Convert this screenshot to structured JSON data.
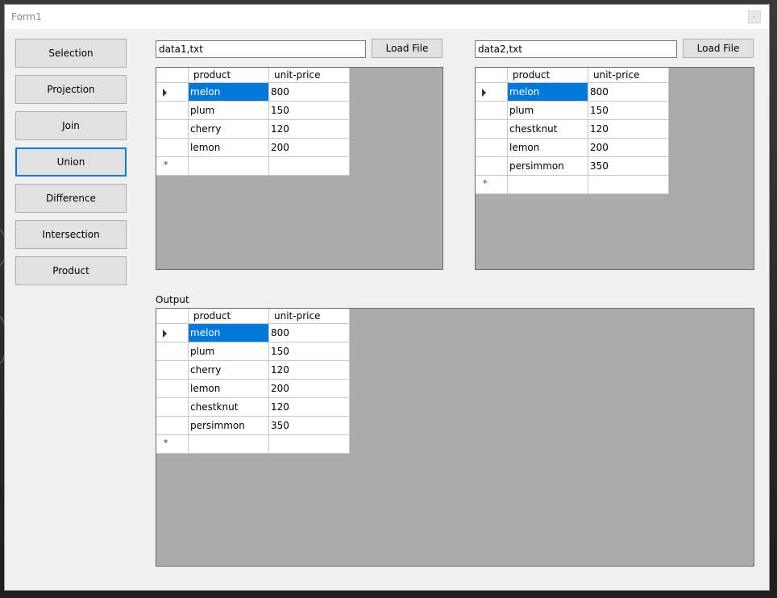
{
  "window": {
    "title": "Form1",
    "minimize_glyph": "-"
  },
  "operations": [
    {
      "label": "Selection"
    },
    {
      "label": "Projection"
    },
    {
      "label": "Join"
    },
    {
      "label": "Union"
    },
    {
      "label": "Difference"
    },
    {
      "label": "Intersection"
    },
    {
      "label": "Product"
    }
  ],
  "active_operation": "Union",
  "input1": {
    "path": "data1,txt",
    "load_label": "Load File",
    "columns": [
      "product",
      "unit-price"
    ],
    "rows": [
      [
        "melon",
        "800"
      ],
      [
        "plum",
        "150"
      ],
      [
        "cherry",
        "120"
      ],
      [
        "lemon",
        "200"
      ]
    ]
  },
  "input2": {
    "path": "data2,txt",
    "load_label": "Load File",
    "columns": [
      "product",
      "unit-price"
    ],
    "rows": [
      [
        "melon",
        "800"
      ],
      [
        "plum",
        "150"
      ],
      [
        "chestknut",
        "120"
      ],
      [
        "lemon",
        "200"
      ],
      [
        "persimmon",
        "350"
      ]
    ]
  },
  "output": {
    "label": "Output",
    "columns": [
      "product",
      "unit-price"
    ],
    "rows": [
      [
        "melon",
        "800"
      ],
      [
        "plum",
        "150"
      ],
      [
        "cherry",
        "120"
      ],
      [
        "lemon",
        "200"
      ],
      [
        "chestknut",
        "120"
      ],
      [
        "persimmon",
        "350"
      ]
    ]
  },
  "glyphs": {
    "current_row": "▶",
    "new_row": "*"
  }
}
